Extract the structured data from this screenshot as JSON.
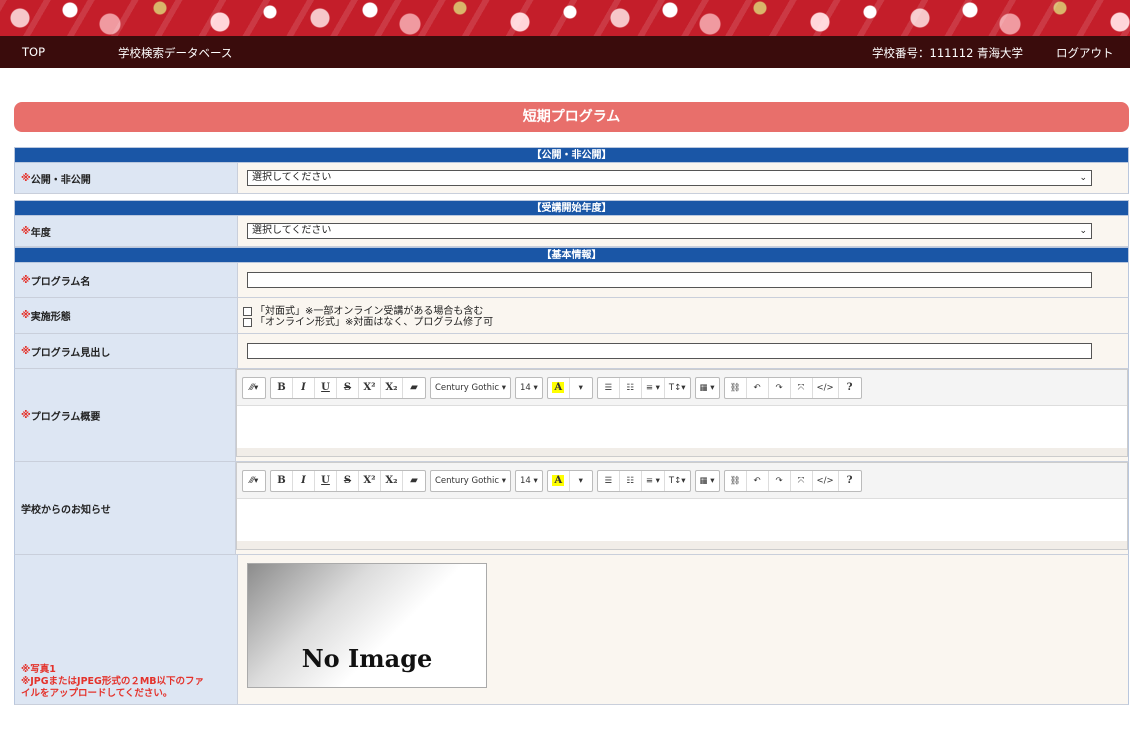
{
  "header": {
    "nav_top": "TOP",
    "nav_db": "学校検索データベース",
    "school_info": "学校番号：111112 青海大学",
    "logout": "ログアウト"
  },
  "page_title": "短期プログラム",
  "required_mark": "※",
  "sections": {
    "public": "【公開・非公開】",
    "start_year": "【受講開始年度】",
    "basic": "【基本情報】"
  },
  "fields": {
    "public_label": "公開・非公開",
    "public_value": "選択してください",
    "year_label": "年度",
    "year_value": "選択してください",
    "program_name_label": "プログラム名",
    "program_name_value": "",
    "format_label": "実施形態",
    "format_option1": "「対面式」※一部オンライン受講がある場合も含む",
    "format_option2": "「オンライン形式」※対面はなく、プログラム修了可",
    "headline_label": "プログラム見出し",
    "headline_value": "",
    "summary_label": "プログラム概要",
    "notice_label": "学校からのお知らせ",
    "photo_label_line1": "※写真1",
    "photo_label_line2": "※JPGまたはJPEG形式の２MB以下のファ",
    "photo_label_line3": "イルをアップロードしてください。",
    "no_image": "No Image"
  },
  "editor_toolbar": {
    "style": "⁄⁄⁄▾",
    "bold": "B",
    "italic": "I",
    "underline": "U",
    "strike": "S",
    "superscript": "X²",
    "subscript": "X₂",
    "eraser": "▰",
    "font_name": "Century Gothic ▾",
    "font_size": "14 ▾",
    "color": "A",
    "color_caret": "▾",
    "ul": "☰",
    "ol": "☷",
    "align": "≡ ▾",
    "height": "T↕▾",
    "table": "▦ ▾",
    "link": "⛓",
    "undo": "↶",
    "redo": "↷",
    "fullscreen": "⤧",
    "code": "</>",
    "help": "?"
  }
}
